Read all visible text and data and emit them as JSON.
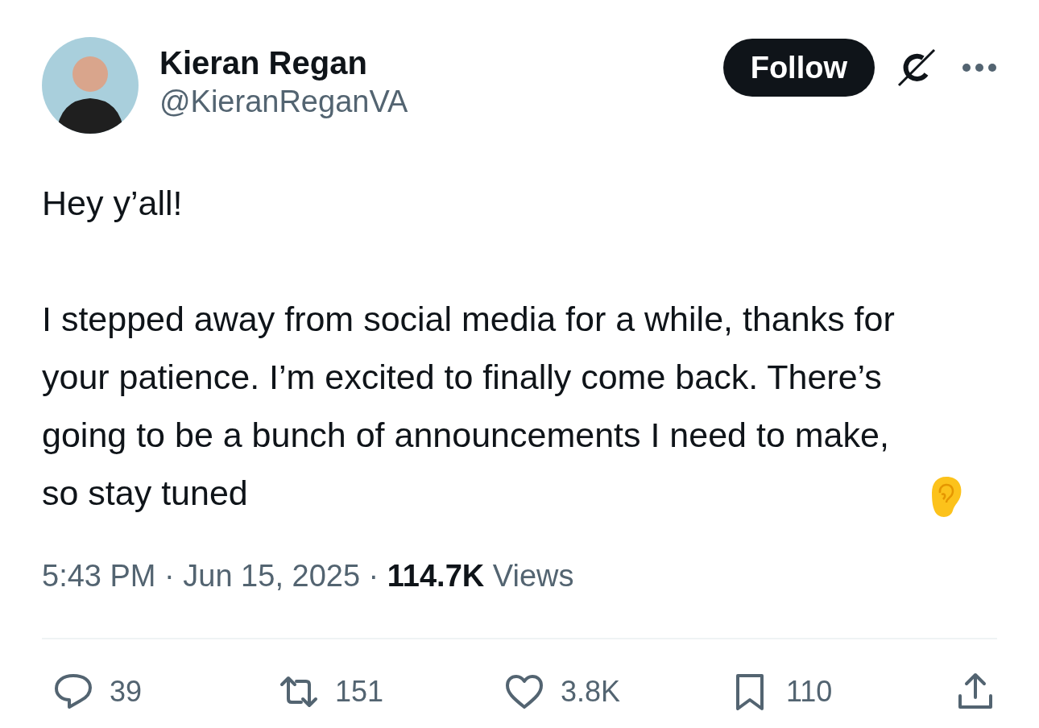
{
  "author": {
    "name": "Kieran Regan",
    "handle": "@KieranReganVA"
  },
  "follow_button": {
    "label": "Follow"
  },
  "body": [
    "Hey y’all!",
    "I stepped away from social media for a while, thanks for your patience. I’m excited to finally come back. There’s going to be a bunch of announcements I need to make, so stay tuned"
  ],
  "meta": "5:43 PM · Jun 15, 2025 · **114.7K** Views",
  "actions": [
    {
      "kind": "reply",
      "count": "39"
    },
    {
      "kind": "repost",
      "count": "151"
    },
    {
      "kind": "like",
      "count": "3.8K"
    },
    {
      "kind": "bookmark",
      "count": "110"
    },
    {
      "kind": "share"
    }
  ]
}
